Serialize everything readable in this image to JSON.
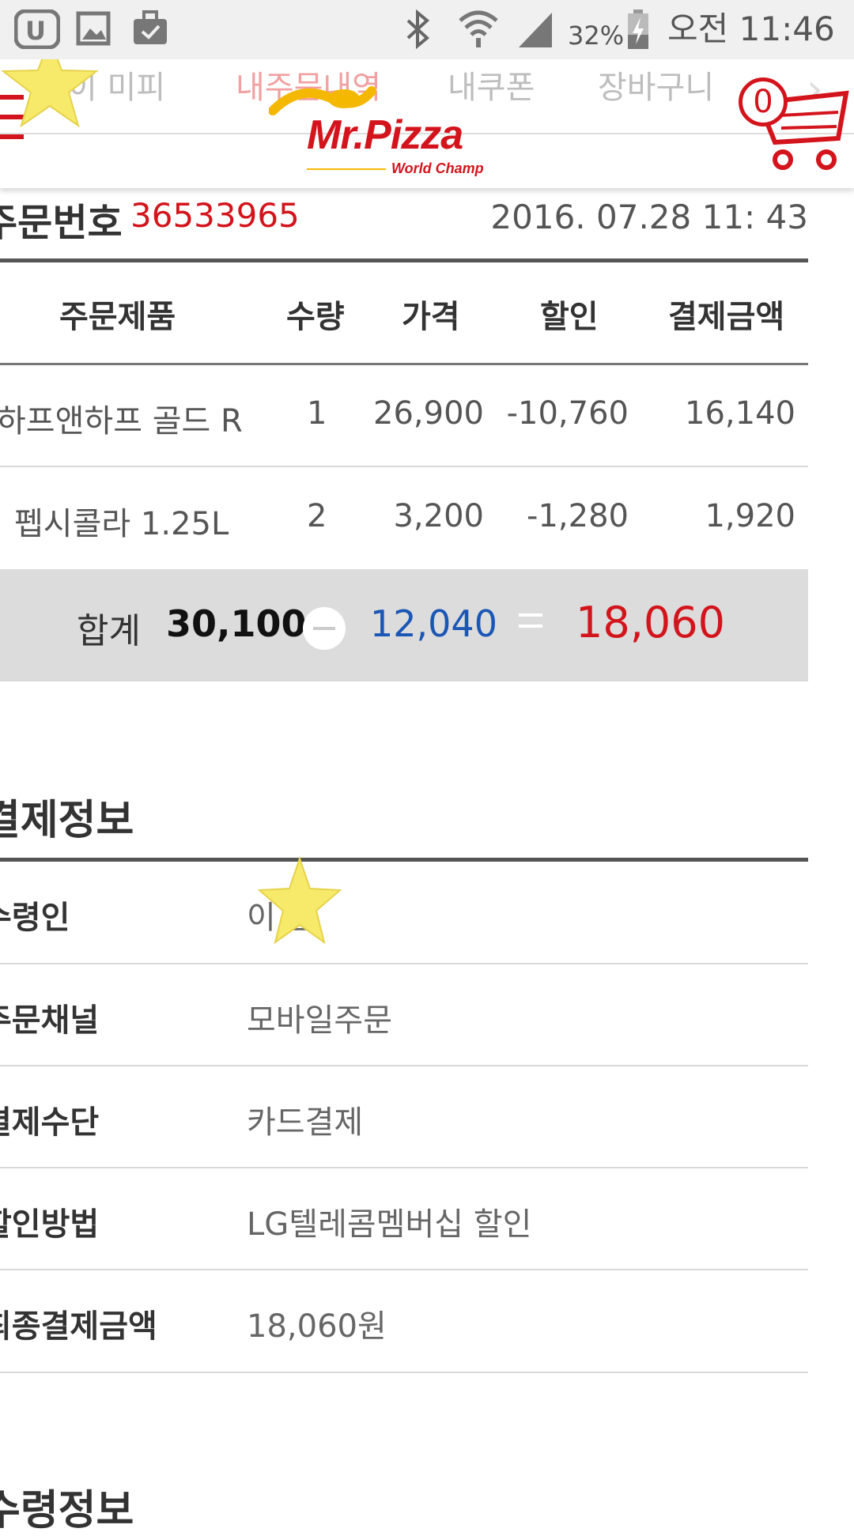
{
  "status_bar": {
    "battery": "32%",
    "time": "오전 11:46",
    "icons": [
      "u-plus-icon",
      "gallery-icon",
      "briefcase-icon",
      "bluetooth-icon",
      "wifi-icon",
      "signal-icon",
      "battery-charging-icon"
    ]
  },
  "nav": {
    "links": [
      "이 미피",
      "내주문내역",
      "내쿠폰",
      "장바구니"
    ],
    "logo_main": "Mr.Pizza",
    "logo_sub": "World Champ",
    "cart_count": "0"
  },
  "order": {
    "label": "주문번호",
    "number": "36533965",
    "datetime": "2016. 07.28 11: 43"
  },
  "table": {
    "headers": [
      "주문제품",
      "수량",
      "가격",
      "할인",
      "결제금액"
    ],
    "rows": [
      {
        "product": "하프앤하프 골드 R",
        "qty": "1",
        "price": "26,900",
        "discount": "-10,760",
        "amount": "16,140"
      },
      {
        "product": "펩시콜라 1.25L",
        "qty": "2",
        "price": "3,200",
        "discount": "-1,280",
        "amount": "1,920"
      }
    ]
  },
  "total": {
    "label": "합계",
    "sum": "30,100",
    "discount": "12,040",
    "final": "18,060"
  },
  "payment": {
    "title": "결제정보",
    "rows": [
      {
        "label": "수령인",
        "value": "이 인"
      },
      {
        "label": "주문채널",
        "value": "모바일주문"
      },
      {
        "label": "결제수단",
        "value": "카드결제"
      },
      {
        "label": "할인방법",
        "value": "LG텔레콤멤버십 할인"
      },
      {
        "label": "최종결제금액",
        "value": "18,060원"
      }
    ]
  },
  "receive": {
    "title": "수령정보"
  },
  "colors": {
    "brand_red": "#d4141c",
    "discount_blue": "#1a56b5",
    "total_bg": "#dcdcdc",
    "star_yellow": "#f7ea6a"
  }
}
